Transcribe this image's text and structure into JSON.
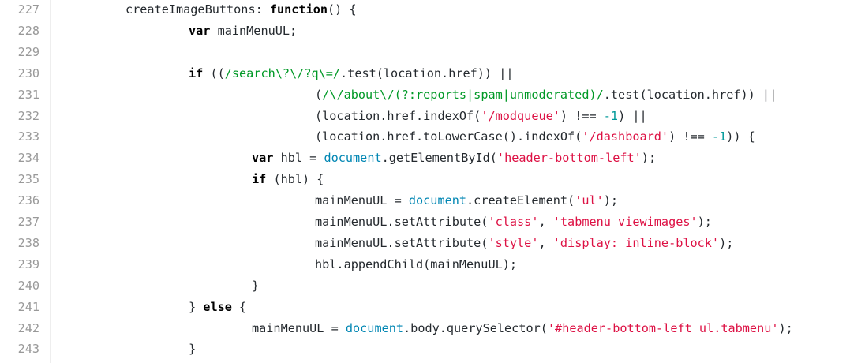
{
  "editor": {
    "lines": [
      {
        "number": "227",
        "indent": 0,
        "tokens": [
          {
            "t": "pl",
            "v": "createImageButtons: "
          },
          {
            "t": "kw",
            "v": "function"
          },
          {
            "t": "pl",
            "v": "() {"
          }
        ]
      },
      {
        "number": "228",
        "indent": 1,
        "tokens": [
          {
            "t": "kw",
            "v": "var"
          },
          {
            "t": "pl",
            "v": " mainMenuUL;"
          }
        ]
      },
      {
        "number": "229",
        "indent": 0,
        "tokens": []
      },
      {
        "number": "230",
        "indent": 1,
        "tokens": [
          {
            "t": "kw",
            "v": "if"
          },
          {
            "t": "pl",
            "v": " (("
          },
          {
            "t": "rx",
            "v": "/search\\?\\/?q\\=/"
          },
          {
            "t": "pl",
            "v": ".test(location.href)) ||"
          }
        ]
      },
      {
        "number": "231",
        "indent": 3,
        "tokens": [
          {
            "t": "pl",
            "v": "("
          },
          {
            "t": "rx",
            "v": "/\\/about\\/(?:reports|spam|unmoderated)/"
          },
          {
            "t": "pl",
            "v": ".test(location.href)) ||"
          }
        ]
      },
      {
        "number": "232",
        "indent": 3,
        "tokens": [
          {
            "t": "pl",
            "v": "(location.href.indexOf("
          },
          {
            "t": "str",
            "v": "'/modqueue'"
          },
          {
            "t": "pl",
            "v": ") !== "
          },
          {
            "t": "num",
            "v": "-1"
          },
          {
            "t": "pl",
            "v": ") ||"
          }
        ]
      },
      {
        "number": "233",
        "indent": 3,
        "tokens": [
          {
            "t": "pl",
            "v": "(location.href.toLowerCase().indexOf("
          },
          {
            "t": "str",
            "v": "'/dashboard'"
          },
          {
            "t": "pl",
            "v": ") !== "
          },
          {
            "t": "num",
            "v": "-1"
          },
          {
            "t": "pl",
            "v": ")) {"
          }
        ]
      },
      {
        "number": "234",
        "indent": 2,
        "tokens": [
          {
            "t": "kw",
            "v": "var"
          },
          {
            "t": "pl",
            "v": " hbl = "
          },
          {
            "t": "bi",
            "v": "document"
          },
          {
            "t": "pl",
            "v": ".getElementById("
          },
          {
            "t": "str",
            "v": "'header-bottom-left'"
          },
          {
            "t": "pl",
            "v": ");"
          }
        ]
      },
      {
        "number": "235",
        "indent": 2,
        "tokens": [
          {
            "t": "kw",
            "v": "if"
          },
          {
            "t": "pl",
            "v": " (hbl) {"
          }
        ]
      },
      {
        "number": "236",
        "indent": 3,
        "tokens": [
          {
            "t": "pl",
            "v": "mainMenuUL = "
          },
          {
            "t": "bi",
            "v": "document"
          },
          {
            "t": "pl",
            "v": ".createElement("
          },
          {
            "t": "str",
            "v": "'ul'"
          },
          {
            "t": "pl",
            "v": ");"
          }
        ]
      },
      {
        "number": "237",
        "indent": 3,
        "tokens": [
          {
            "t": "pl",
            "v": "mainMenuUL.setAttribute("
          },
          {
            "t": "str",
            "v": "'class'"
          },
          {
            "t": "pl",
            "v": ", "
          },
          {
            "t": "str",
            "v": "'tabmenu viewimages'"
          },
          {
            "t": "pl",
            "v": ");"
          }
        ]
      },
      {
        "number": "238",
        "indent": 3,
        "tokens": [
          {
            "t": "pl",
            "v": "mainMenuUL.setAttribute("
          },
          {
            "t": "str",
            "v": "'style'"
          },
          {
            "t": "pl",
            "v": ", "
          },
          {
            "t": "str",
            "v": "'display: inline-block'"
          },
          {
            "t": "pl",
            "v": ");"
          }
        ]
      },
      {
        "number": "239",
        "indent": 3,
        "tokens": [
          {
            "t": "pl",
            "v": "hbl.appendChild(mainMenuUL);"
          }
        ]
      },
      {
        "number": "240",
        "indent": 2,
        "tokens": [
          {
            "t": "pl",
            "v": "}"
          }
        ]
      },
      {
        "number": "241",
        "indent": 1,
        "tokens": [
          {
            "t": "pl",
            "v": "} "
          },
          {
            "t": "kw",
            "v": "else"
          },
          {
            "t": "pl",
            "v": " {"
          }
        ]
      },
      {
        "number": "242",
        "indent": 2,
        "tokens": [
          {
            "t": "pl",
            "v": "mainMenuUL = "
          },
          {
            "t": "bi",
            "v": "document"
          },
          {
            "t": "pl",
            "v": ".body.querySelector("
          },
          {
            "t": "str",
            "v": "'#header-bottom-left ul.tabmenu'"
          },
          {
            "t": "pl",
            "v": ");"
          }
        ]
      },
      {
        "number": "243",
        "indent": 1,
        "tokens": [
          {
            "t": "pl",
            "v": "}"
          }
        ]
      }
    ]
  },
  "theme": {
    "line_number_color": "#999999",
    "keyword_color": "#000000",
    "string_color": "#dd1144",
    "regex_color": "#009926",
    "number_color": "#009999",
    "builtin_color": "#0086b3",
    "text_color": "#24292e"
  }
}
